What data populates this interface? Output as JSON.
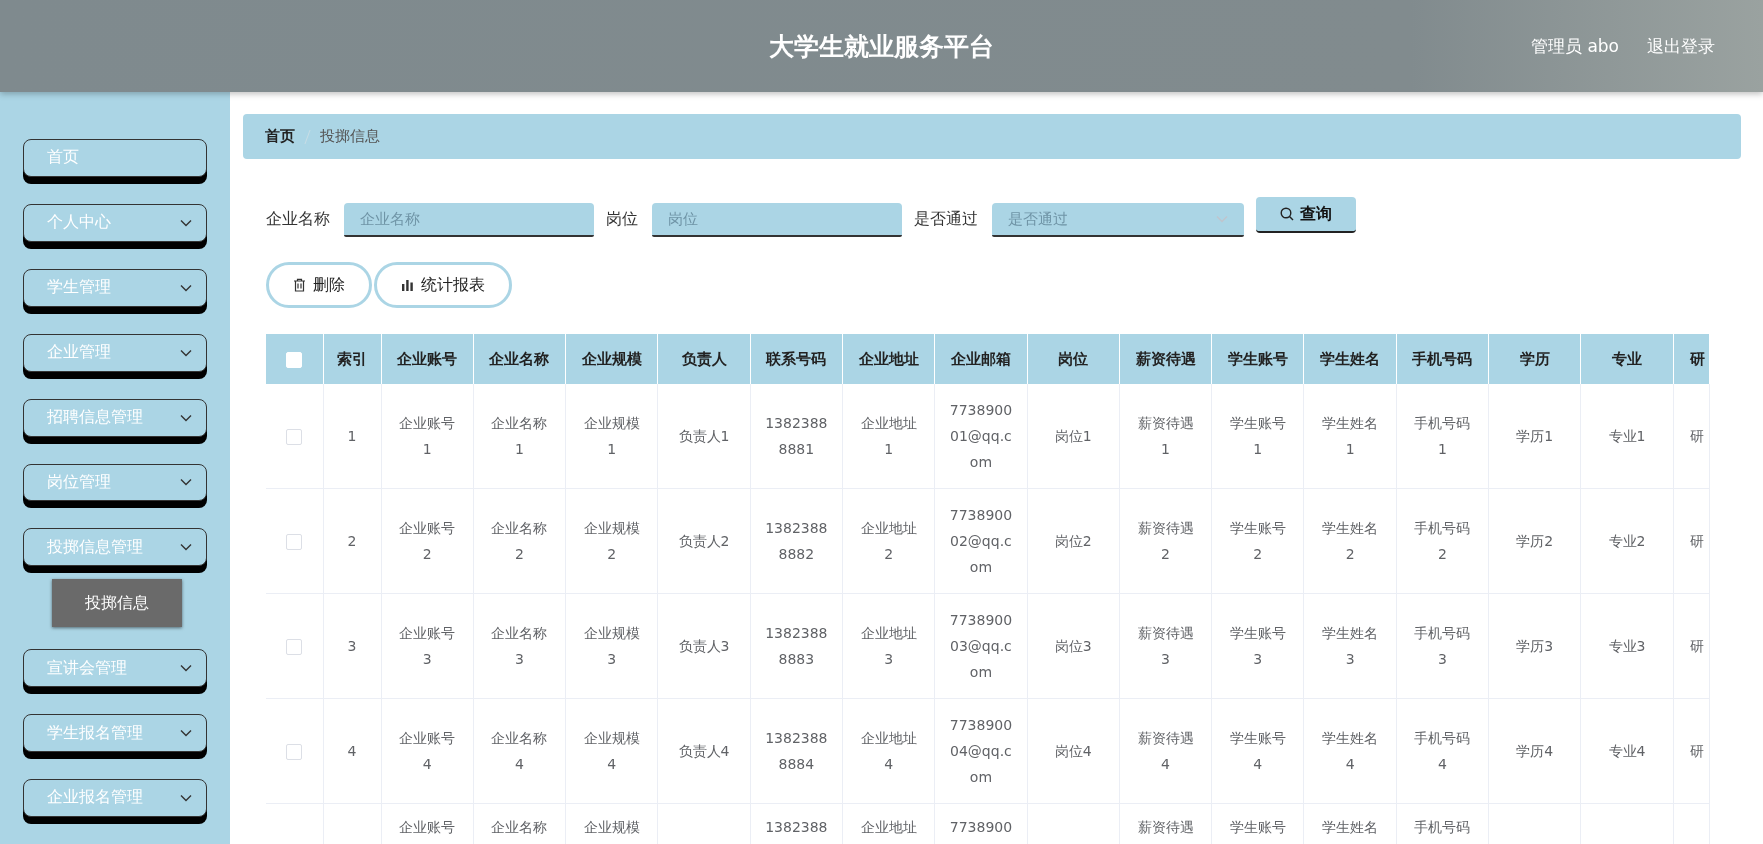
{
  "header": {
    "title": "大学生就业服务平台",
    "user": "管理员 abo",
    "logout": "退出登录"
  },
  "sidebar": {
    "items": [
      {
        "label": "首页",
        "expandable": false
      },
      {
        "label": "个人中心",
        "expandable": true
      },
      {
        "label": "学生管理",
        "expandable": true
      },
      {
        "label": "企业管理",
        "expandable": true
      },
      {
        "label": "招聘信息管理",
        "expandable": true
      },
      {
        "label": "岗位管理",
        "expandable": true
      },
      {
        "label": "投掷信息管理",
        "expandable": true,
        "children": [
          {
            "label": "投掷信息",
            "selected": true
          }
        ]
      },
      {
        "label": "宣讲会管理",
        "expandable": true
      },
      {
        "label": "学生报名管理",
        "expandable": true
      },
      {
        "label": "企业报名管理",
        "expandable": true
      }
    ]
  },
  "breadcrumb": [
    {
      "label": "首页",
      "current": false
    },
    {
      "label": "投掷信息",
      "current": true
    }
  ],
  "filters": [
    {
      "kind": "input",
      "label": "企业名称",
      "placeholder": "企业名称"
    },
    {
      "kind": "input",
      "label": "岗位",
      "placeholder": "岗位"
    },
    {
      "kind": "select",
      "label": "是否通过",
      "placeholder": "是否通过"
    }
  ],
  "search_button": "查询",
  "actions": [
    {
      "kind": "delete",
      "label": "删除"
    },
    {
      "kind": "chart",
      "label": "统计报表"
    }
  ],
  "table": {
    "select_all_checked": false,
    "columns": [
      "索引",
      "企业账号",
      "企业名称",
      "企业规模",
      "负责人",
      "联系号码",
      "企业地址",
      "企业邮箱",
      "岗位",
      "薪资待遇",
      "学生账号",
      "学生姓名",
      "手机号码",
      "学历",
      "专业",
      "研"
    ],
    "rows": [
      {
        "checked": false,
        "cells": [
          "1",
          "企业账号1",
          "企业名称1",
          "企业规模1",
          "负责人1",
          "13823888881",
          "企业地址1",
          "773890001@qq.com",
          "岗位1",
          "薪资待遇1",
          "学生账号1",
          "学生姓名1",
          "手机号码1",
          "学历1",
          "专业1",
          "研"
        ]
      },
      {
        "checked": false,
        "cells": [
          "2",
          "企业账号2",
          "企业名称2",
          "企业规模2",
          "负责人2",
          "13823888882",
          "企业地址2",
          "773890002@qq.com",
          "岗位2",
          "薪资待遇2",
          "学生账号2",
          "学生姓名2",
          "手机号码2",
          "学历2",
          "专业2",
          "研"
        ]
      },
      {
        "checked": false,
        "cells": [
          "3",
          "企业账号3",
          "企业名称3",
          "企业规模3",
          "负责人3",
          "13823888883",
          "企业地址3",
          "773890003@qq.com",
          "岗位3",
          "薪资待遇3",
          "学生账号3",
          "学生姓名3",
          "手机号码3",
          "学历3",
          "专业3",
          "研"
        ]
      },
      {
        "checked": false,
        "cells": [
          "4",
          "企业账号4",
          "企业名称4",
          "企业规模4",
          "负责人4",
          "13823888884",
          "企业地址4",
          "773890004@qq.com",
          "岗位4",
          "薪资待遇4",
          "学生账号4",
          "学生姓名4",
          "手机号码4",
          "学历4",
          "专业4",
          "研"
        ]
      },
      {
        "cells": [
          null,
          "企业账号",
          "企业名称",
          "企业规模",
          null,
          "1382388",
          "企业地址",
          "7738900",
          null,
          "薪资待遇",
          "学生账号",
          "学生姓名",
          "手机号码",
          null,
          null,
          null
        ]
      }
    ]
  }
}
